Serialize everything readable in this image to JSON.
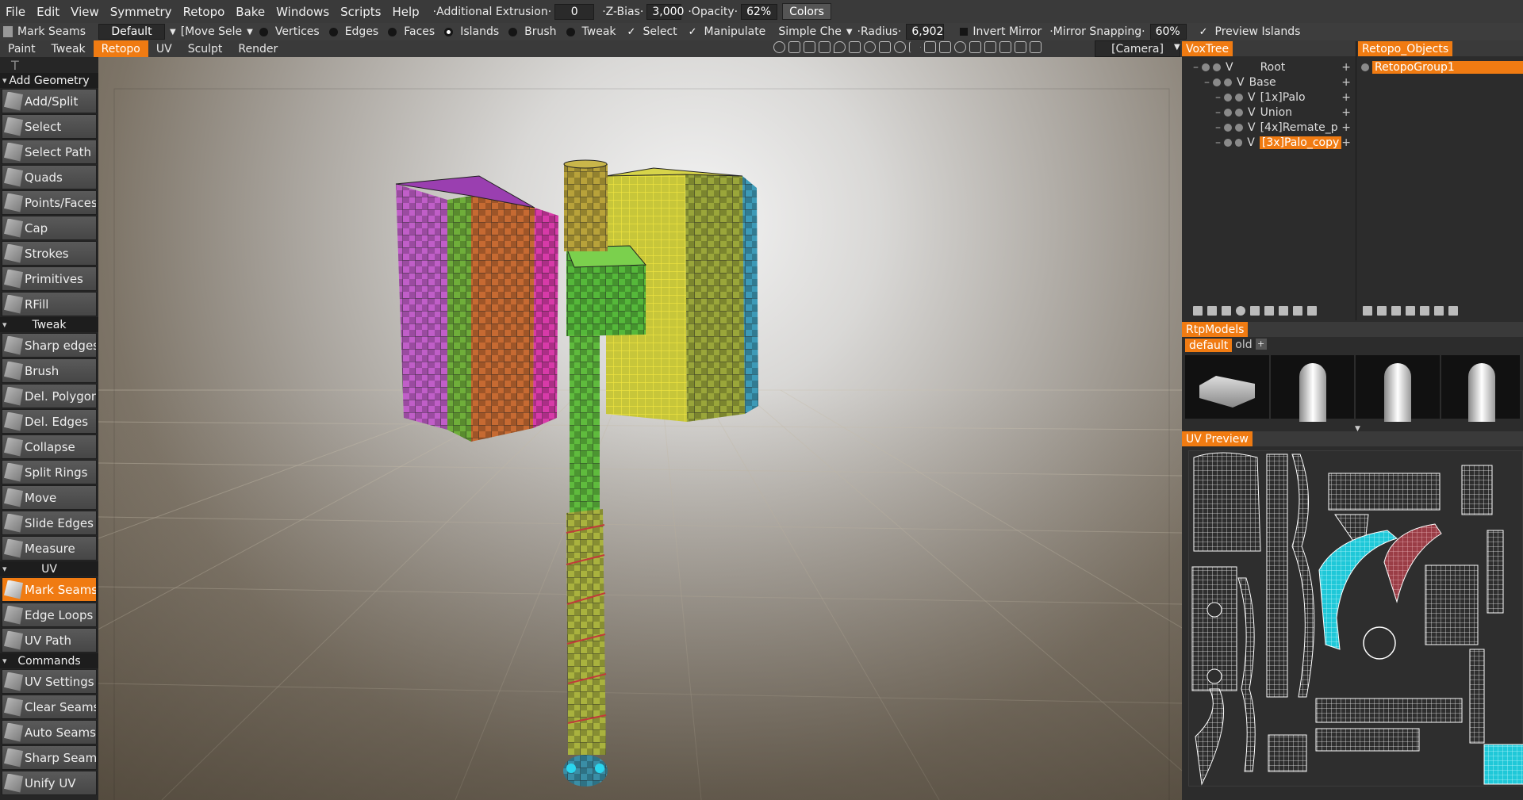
{
  "menu": [
    "File",
    "Edit",
    "View",
    "Symmetry",
    "Retopo",
    "Bake",
    "Windows",
    "Scripts",
    "Help"
  ],
  "topbar": {
    "extrusion_label": "·Additional Extrusion·",
    "extrusion_value": "0",
    "zbias_label": "·Z-Bias·",
    "zbias_value": "3,000",
    "opacity_label": "·Opacity·",
    "opacity_value": "62%",
    "colors_button": "Colors"
  },
  "toolbar": {
    "mode_label": "Mark Seams",
    "preset": "Default",
    "move_select": "[Move Sele",
    "vertices": "Vertices",
    "edges": "Edges",
    "faces": "Faces",
    "islands": "Islands",
    "brush": "Brush",
    "tweak": "Tweak",
    "select": "Select",
    "manipulate": "Manipulate",
    "simple": "Simple Che",
    "radius_label": "·Radius·",
    "radius_value": "6,902",
    "invert_mirror": "Invert Mirror",
    "mirror_snapping": "·Mirror Snapping·",
    "snapping_value": "60%",
    "preview_islands": "Preview Islands"
  },
  "rooms": [
    "Paint",
    "Tweak",
    "Retopo",
    "UV",
    "Sculpt",
    "Render"
  ],
  "active_room": "Retopo",
  "camera": "[Camera]",
  "left_panel": {
    "sections": {
      "add_geometry": "Add Geometry",
      "tweak": "Tweak",
      "uv": "UV",
      "commands": "Commands"
    },
    "add_geometry": [
      "Add/Split",
      "Select",
      "Select Path",
      "Quads",
      "Points/Faces",
      "Cap",
      "Strokes",
      "Primitives",
      "RFill"
    ],
    "tweak": [
      "Sharp edges",
      "Brush",
      "Del. Polygons",
      "Del. Edges",
      "Collapse",
      "Split Rings",
      "Move",
      "Slide Edges",
      "Measure"
    ],
    "uv": [
      "Mark Seams",
      "Edge Loops",
      "UV Path"
    ],
    "commands": [
      "UV Settings",
      "Clear Seams",
      "Auto Seams",
      "Sharp Seams",
      "Unify UV"
    ],
    "active_tool": "Mark Seams"
  },
  "voxtree": {
    "tab": "VoxTree",
    "rows": [
      "Root",
      "Base",
      "[1x]Palo",
      "Union",
      "[4x]Remate_p",
      "[3x]Palo_copy"
    ],
    "selected": "[3x]Palo_copy",
    "visibility_marker": "V"
  },
  "retopo_objects": {
    "tab": "Retopo_Objects",
    "rows": [
      "RetopoGroup1"
    ]
  },
  "rtp_models": {
    "tab": "RtpModels",
    "tabs": [
      "default",
      "old"
    ],
    "active": "default"
  },
  "uv_preview": {
    "tab": "UV Preview"
  },
  "colors": {
    "accent": "#f07b12",
    "panel": "#2c2c2c",
    "seam_cyan": "#27e0f0",
    "seam_red": "#c23a3a"
  }
}
